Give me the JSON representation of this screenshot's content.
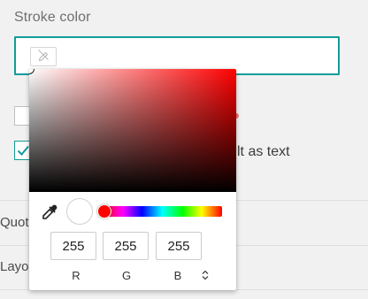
{
  "stroke": {
    "label": "Stroke color",
    "selected_color": "#ffffff",
    "swatch_icon": "pen-slash-icon",
    "accent": "#119c9a"
  },
  "background": {
    "checkbox_text": "lt as text"
  },
  "rows": [
    {
      "label": "Quot"
    },
    {
      "label": "Layo"
    }
  ],
  "picker": {
    "hue_color": "#ff0000",
    "preview_color": "#ffffff",
    "eyedropper_icon": "eyedropper-icon",
    "channels": [
      {
        "value": "255",
        "label": "R"
      },
      {
        "value": "255",
        "label": "G"
      },
      {
        "value": "255",
        "label": "B"
      }
    ],
    "mode_toggle_icon": "up-down-chevron-icon"
  }
}
